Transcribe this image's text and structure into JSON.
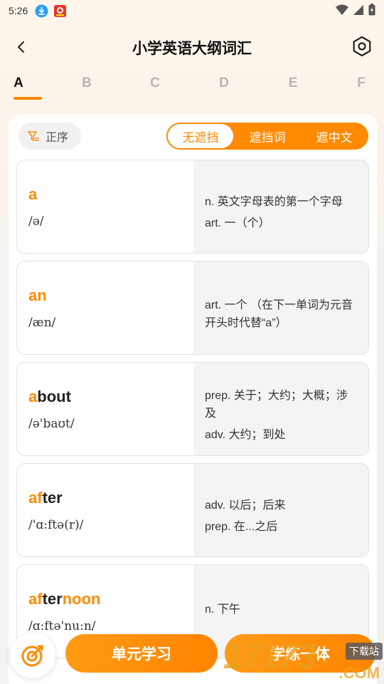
{
  "status_bar": {
    "time": "5:26"
  },
  "header": {
    "title": "小学英语大纲词汇"
  },
  "tabs": [
    "A",
    "B",
    "C",
    "D",
    "E",
    "F"
  ],
  "toolbar": {
    "sort_label": "正序",
    "modes": [
      "无遮挡",
      "遮挡词",
      "遮中文"
    ],
    "active_mode": "无遮挡"
  },
  "words": [
    {
      "highlight": "a",
      "rest": "",
      "phonetic": "/ə/",
      "defs": [
        "n. 英文字母表的第一个字母",
        "art. 一（个）"
      ]
    },
    {
      "highlight": "an",
      "rest": "",
      "phonetic": "/æn/",
      "defs": [
        "art. 一个 （在下一单词为元音开头时代替“a”）"
      ]
    },
    {
      "highlight": "a",
      "rest": "bout",
      "phonetic": "/ə'baʊt/",
      "defs": [
        "prep. 关于；大约；大概；涉及",
        "adv. 大约；到处"
      ]
    },
    {
      "highlight": "af",
      "rest": "ter",
      "phonetic": "/'ɑ:ftə(r)/",
      "defs": [
        "adv. 以后；后来",
        "prep. 在...之后"
      ]
    },
    {
      "highlight": "af",
      "rest": "ter",
      "suffix": "noon",
      "phonetic": "/ɑ:ftə'nu:n/",
      "defs": [
        "n. 下午"
      ]
    }
  ],
  "bottom": {
    "primary_button": "单元学习",
    "secondary_button": "学练一体"
  },
  "watermark": {
    "number": "17173",
    "tag": "下载站",
    "domain": ".COM"
  },
  "colors": {
    "accent": "#ff8a00",
    "tab_inactive": "#b5b5b5"
  },
  "icons": [
    "download-icon",
    "app-notification-icon",
    "wifi-icon",
    "signal-icon",
    "battery-icon",
    "back-arrow-icon",
    "settings-hexagon-icon",
    "sort-filter-icon",
    "target-icon"
  ]
}
